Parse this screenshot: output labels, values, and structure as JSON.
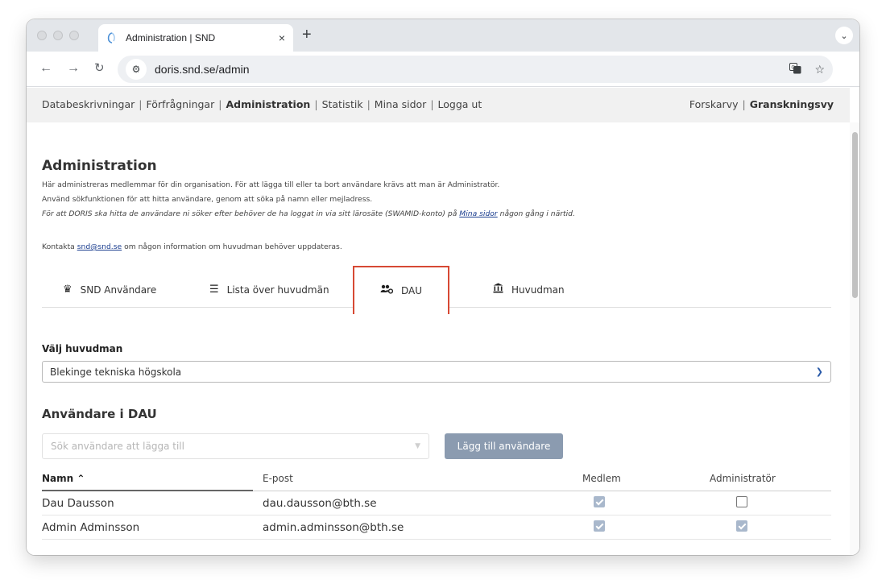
{
  "browser": {
    "tab_title": "Administration | SND",
    "tab_close": "×",
    "new_tab": "+",
    "tab_menu": "⌄",
    "url": "doris.snd.se/admin"
  },
  "topnav": {
    "items": [
      "Databeskrivningar",
      "Förfrågningar",
      "Administration",
      "Statistik",
      "Mina sidor",
      "Logga ut"
    ],
    "views": [
      "Forskarvy",
      "Granskningsvy"
    ],
    "separator": "|"
  },
  "page": {
    "title": "Administration",
    "intro1": "Här administreras medlemmar för din organisation. För att lägga till eller ta bort användare krävs att man är Administratör.",
    "intro2": "Använd sökfunktionen för att hitta användare, genom att söka på namn eller mejladress.",
    "intro3_a": "För att DORIS ska hitta de användare ni söker efter behöver de ha loggat in via sitt lärosäte (SWAMID-konto) på ",
    "intro3_link": "Mina sidor",
    "intro3_b": " någon gång i närtid.",
    "contact_a": "Kontakta ",
    "contact_link": "snd@snd.se",
    "contact_b": " om någon information om huvudman behöver uppdateras."
  },
  "tabs": [
    {
      "label": "SND Användare",
      "icon": "crown-icon"
    },
    {
      "label": "Lista över huvudmän",
      "icon": "list-icon"
    },
    {
      "label": "DAU",
      "icon": "users-gear-icon"
    },
    {
      "label": "Huvudman",
      "icon": "institution-icon"
    }
  ],
  "select": {
    "label": "Välj huvudman",
    "value": "Blekinge tekniska högskola"
  },
  "users_section": {
    "title": "Användare i DAU",
    "search_placeholder": "Sök användare att lägga till",
    "add_button": "Lägg till användare"
  },
  "table": {
    "headers": [
      "Namn",
      "E-post",
      "Medlem",
      "Administratör"
    ],
    "rows": [
      {
        "name": "Dau Dausson",
        "email": "dau.dausson@bth.se",
        "member": true,
        "admin": false
      },
      {
        "name": "Admin Adminsson",
        "email": "admin.adminsson@bth.se",
        "member": true,
        "admin": true
      }
    ]
  },
  "colors": {
    "highlight": "#d74934",
    "button": "#8b9bb0",
    "link": "#1a3d8f"
  }
}
